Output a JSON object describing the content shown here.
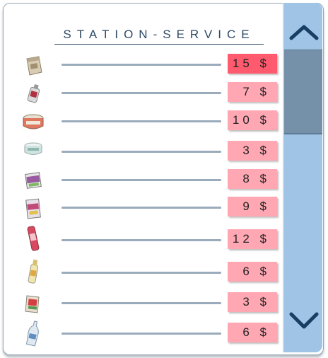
{
  "title": "STATION-SERVICE",
  "items": [
    {
      "icon": "flour-sack-icon",
      "price": "15 $",
      "selected": true
    },
    {
      "icon": "spray-can-icon",
      "price": "7 $"
    },
    {
      "icon": "food-tin-icon",
      "price": "10 $"
    },
    {
      "icon": "small-tin-icon",
      "price": "3 $"
    },
    {
      "icon": "canned-food-icon",
      "price": "8 $"
    },
    {
      "icon": "tin-can-icon",
      "price": "9 $"
    },
    {
      "icon": "drink-can-icon",
      "price": "12 $"
    },
    {
      "icon": "bottle-icon",
      "price": "6 $"
    },
    {
      "icon": "snack-box-icon",
      "price": "3 $"
    },
    {
      "icon": "water-bottle-icon",
      "price": "6 $"
    }
  ],
  "colors": {
    "price_bg": "#ffa8b4",
    "price_selected_bg": "#ff5a6e",
    "scrollbar_bg": "#9fc4e6",
    "scroll_thumb": "#7591a9",
    "arrow": "#173e63"
  }
}
